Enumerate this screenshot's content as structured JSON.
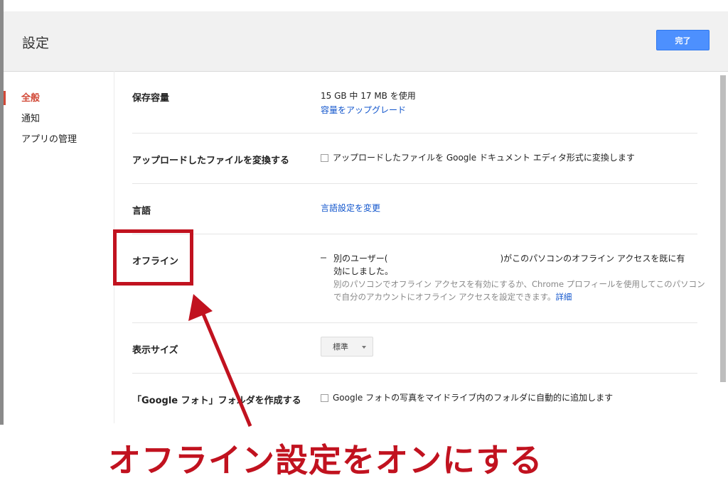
{
  "header": {
    "title": "設定",
    "done_label": "完了"
  },
  "nav": {
    "items": [
      {
        "label": "全般",
        "active": true
      },
      {
        "label": "通知",
        "active": false
      },
      {
        "label": "アプリの管理",
        "active": false
      }
    ]
  },
  "settings": {
    "storage": {
      "label": "保存容量",
      "usage": "15 GB 中 17 MB を使用",
      "upgrade_link": "容量をアップグレード"
    },
    "convert": {
      "label": "アップロードしたファイルを変換する",
      "checkbox_label": "アップロードしたファイルを Google ドキュメント エディタ形式に変換します",
      "checked": false
    },
    "language": {
      "label": "言語",
      "link": "言語設定を変更"
    },
    "offline": {
      "label": "オフライン",
      "status_line1_part1": "別のユーザー(",
      "status_line1_part2": ")がこのパソコンのオフライン アクセスを既に有",
      "status_line2": "効にしました。",
      "help_line1": "別のパソコンでオフライン アクセスを有効にするか、Chrome プロフィールを使用してこのパソコン",
      "help_line2": "で自分のアカウントにオフライン アクセスを設定できます。",
      "details_link": "詳細"
    },
    "density": {
      "label": "表示サイズ",
      "selected": "標準"
    },
    "photos": {
      "label": "「Google フォト」フォルダを作成する",
      "checkbox_label": "Google フォトの写真をマイドライブ内のフォルダに自動的に追加します",
      "checked": false
    }
  },
  "annotation": {
    "caption": "オフライン設定をオンにする",
    "color": "#c1121f"
  },
  "colors": {
    "accent": "#4d90fe",
    "nav_active": "#d14836",
    "link": "#1155cc"
  }
}
